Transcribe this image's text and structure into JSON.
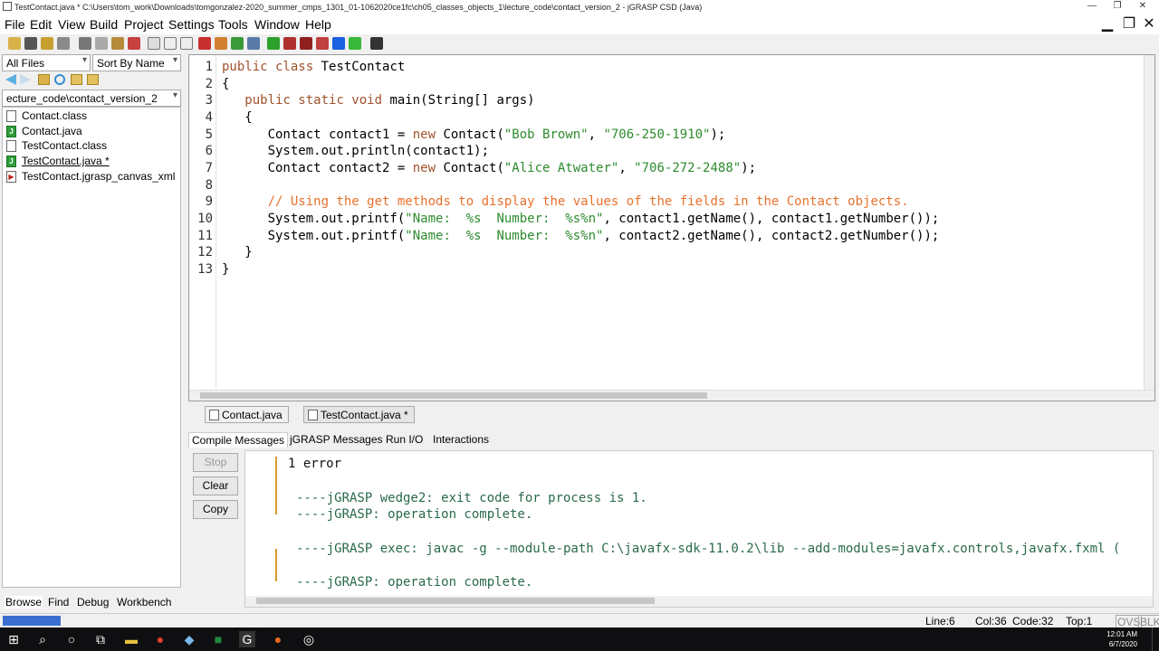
{
  "window": {
    "title": "TestContact.java *   C:\\Users\\tom_work\\Downloads\\tomgonzalez-2020_summer_cmps_1301_01-1062020ce1fc\\ch05_classes_objects_1\\lecture_code\\contact_version_2 - jGRASP CSD (Java)",
    "min": "—",
    "restore": "❐",
    "close": "✕"
  },
  "menu": [
    "File",
    "Edit",
    "View",
    "Build",
    "Project",
    "Settings",
    "Tools",
    "Window",
    "Help"
  ],
  "browse": {
    "filter": "All Files",
    "sort": "Sort By Name",
    "folder": "ecture_code\\contact_version_2",
    "files": [
      {
        "name": "Contact.class",
        "icon": "file-icon",
        "glyph": ""
      },
      {
        "name": "Contact.java",
        "icon": "java-file-icon",
        "glyph": "J"
      },
      {
        "name": "TestContact.class",
        "icon": "file-icon",
        "glyph": ""
      },
      {
        "name": "TestContact.java *",
        "icon": "java-file-icon",
        "glyph": "J"
      },
      {
        "name": "TestContact.jgrasp_canvas_xml",
        "icon": "canvas-file-icon",
        "glyph": "▶"
      }
    ],
    "tabs": [
      "Browse",
      "Find",
      "Debug",
      "Workbench"
    ]
  },
  "editor": {
    "line_numbers": [
      "1",
      "2",
      "3",
      "4",
      "5",
      "6",
      "7",
      "8",
      "9",
      "10",
      "11",
      "12",
      "13"
    ]
  },
  "doc_tabs": [
    "Contact.java",
    "TestContact.java *"
  ],
  "messages": {
    "tabs": [
      "Compile Messages",
      "jGRASP Messages",
      "Run I/O",
      "Interactions"
    ],
    "buttons": {
      "stop": "Stop",
      "clear": "Clear",
      "copy": "Copy"
    },
    "lines": [
      "1 error",
      "----jGRASP wedge2: exit code for process is 1.",
      "----jGRASP: operation complete.",
      "----jGRASP exec: javac -g --module-path C:\\javafx-sdk-11.0.2\\lib --add-modules=javafx.controls,javafx.fxml (",
      "----jGRASP: operation complete."
    ]
  },
  "status": {
    "line": "Line:6",
    "col": "Col:36",
    "code": "Code:32",
    "top": "Top:1",
    "ovs": "OVS",
    "blk": "BLK"
  },
  "taskbar": {
    "time": "12:01 AM",
    "date": "6/7/2020"
  },
  "colors": {
    "keyword": "#a0522d",
    "string": "#2e8b2e",
    "comment": "#e8712c",
    "message": "#2a6a4a"
  }
}
